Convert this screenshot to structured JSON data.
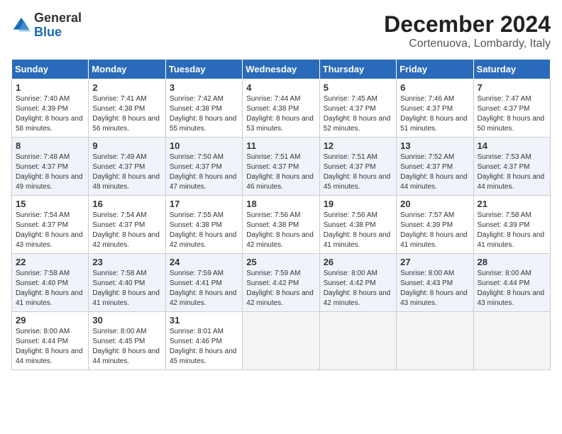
{
  "header": {
    "logo_general": "General",
    "logo_blue": "Blue",
    "title": "December 2024",
    "location": "Cortenuova, Lombardy, Italy"
  },
  "days_of_week": [
    "Sunday",
    "Monday",
    "Tuesday",
    "Wednesday",
    "Thursday",
    "Friday",
    "Saturday"
  ],
  "weeks": [
    [
      {
        "day": "1",
        "sunrise": "Sunrise: 7:40 AM",
        "sunset": "Sunset: 4:39 PM",
        "daylight": "Daylight: 8 hours and 58 minutes."
      },
      {
        "day": "2",
        "sunrise": "Sunrise: 7:41 AM",
        "sunset": "Sunset: 4:38 PM",
        "daylight": "Daylight: 8 hours and 56 minutes."
      },
      {
        "day": "3",
        "sunrise": "Sunrise: 7:42 AM",
        "sunset": "Sunset: 4:38 PM",
        "daylight": "Daylight: 8 hours and 55 minutes."
      },
      {
        "day": "4",
        "sunrise": "Sunrise: 7:44 AM",
        "sunset": "Sunset: 4:38 PM",
        "daylight": "Daylight: 8 hours and 53 minutes."
      },
      {
        "day": "5",
        "sunrise": "Sunrise: 7:45 AM",
        "sunset": "Sunset: 4:37 PM",
        "daylight": "Daylight: 8 hours and 52 minutes."
      },
      {
        "day": "6",
        "sunrise": "Sunrise: 7:46 AM",
        "sunset": "Sunset: 4:37 PM",
        "daylight": "Daylight: 8 hours and 51 minutes."
      },
      {
        "day": "7",
        "sunrise": "Sunrise: 7:47 AM",
        "sunset": "Sunset: 4:37 PM",
        "daylight": "Daylight: 8 hours and 50 minutes."
      }
    ],
    [
      {
        "day": "8",
        "sunrise": "Sunrise: 7:48 AM",
        "sunset": "Sunset: 4:37 PM",
        "daylight": "Daylight: 8 hours and 49 minutes."
      },
      {
        "day": "9",
        "sunrise": "Sunrise: 7:49 AM",
        "sunset": "Sunset: 4:37 PM",
        "daylight": "Daylight: 8 hours and 48 minutes."
      },
      {
        "day": "10",
        "sunrise": "Sunrise: 7:50 AM",
        "sunset": "Sunset: 4:37 PM",
        "daylight": "Daylight: 8 hours and 47 minutes."
      },
      {
        "day": "11",
        "sunrise": "Sunrise: 7:51 AM",
        "sunset": "Sunset: 4:37 PM",
        "daylight": "Daylight: 8 hours and 46 minutes."
      },
      {
        "day": "12",
        "sunrise": "Sunrise: 7:51 AM",
        "sunset": "Sunset: 4:37 PM",
        "daylight": "Daylight: 8 hours and 45 minutes."
      },
      {
        "day": "13",
        "sunrise": "Sunrise: 7:52 AM",
        "sunset": "Sunset: 4:37 PM",
        "daylight": "Daylight: 8 hours and 44 minutes."
      },
      {
        "day": "14",
        "sunrise": "Sunrise: 7:53 AM",
        "sunset": "Sunset: 4:37 PM",
        "daylight": "Daylight: 8 hours and 44 minutes."
      }
    ],
    [
      {
        "day": "15",
        "sunrise": "Sunrise: 7:54 AM",
        "sunset": "Sunset: 4:37 PM",
        "daylight": "Daylight: 8 hours and 43 minutes."
      },
      {
        "day": "16",
        "sunrise": "Sunrise: 7:54 AM",
        "sunset": "Sunset: 4:37 PM",
        "daylight": "Daylight: 8 hours and 42 minutes."
      },
      {
        "day": "17",
        "sunrise": "Sunrise: 7:55 AM",
        "sunset": "Sunset: 4:38 PM",
        "daylight": "Daylight: 8 hours and 42 minutes."
      },
      {
        "day": "18",
        "sunrise": "Sunrise: 7:56 AM",
        "sunset": "Sunset: 4:38 PM",
        "daylight": "Daylight: 8 hours and 42 minutes."
      },
      {
        "day": "19",
        "sunrise": "Sunrise: 7:56 AM",
        "sunset": "Sunset: 4:38 PM",
        "daylight": "Daylight: 8 hours and 41 minutes."
      },
      {
        "day": "20",
        "sunrise": "Sunrise: 7:57 AM",
        "sunset": "Sunset: 4:39 PM",
        "daylight": "Daylight: 8 hours and 41 minutes."
      },
      {
        "day": "21",
        "sunrise": "Sunrise: 7:58 AM",
        "sunset": "Sunset: 4:39 PM",
        "daylight": "Daylight: 8 hours and 41 minutes."
      }
    ],
    [
      {
        "day": "22",
        "sunrise": "Sunrise: 7:58 AM",
        "sunset": "Sunset: 4:40 PM",
        "daylight": "Daylight: 8 hours and 41 minutes."
      },
      {
        "day": "23",
        "sunrise": "Sunrise: 7:58 AM",
        "sunset": "Sunset: 4:40 PM",
        "daylight": "Daylight: 8 hours and 41 minutes."
      },
      {
        "day": "24",
        "sunrise": "Sunrise: 7:59 AM",
        "sunset": "Sunset: 4:41 PM",
        "daylight": "Daylight: 8 hours and 42 minutes."
      },
      {
        "day": "25",
        "sunrise": "Sunrise: 7:59 AM",
        "sunset": "Sunset: 4:42 PM",
        "daylight": "Daylight: 8 hours and 42 minutes."
      },
      {
        "day": "26",
        "sunrise": "Sunrise: 8:00 AM",
        "sunset": "Sunset: 4:42 PM",
        "daylight": "Daylight: 8 hours and 42 minutes."
      },
      {
        "day": "27",
        "sunrise": "Sunrise: 8:00 AM",
        "sunset": "Sunset: 4:43 PM",
        "daylight": "Daylight: 8 hours and 43 minutes."
      },
      {
        "day": "28",
        "sunrise": "Sunrise: 8:00 AM",
        "sunset": "Sunset: 4:44 PM",
        "daylight": "Daylight: 8 hours and 43 minutes."
      }
    ],
    [
      {
        "day": "29",
        "sunrise": "Sunrise: 8:00 AM",
        "sunset": "Sunset: 4:44 PM",
        "daylight": "Daylight: 8 hours and 44 minutes."
      },
      {
        "day": "30",
        "sunrise": "Sunrise: 8:00 AM",
        "sunset": "Sunset: 4:45 PM",
        "daylight": "Daylight: 8 hours and 44 minutes."
      },
      {
        "day": "31",
        "sunrise": "Sunrise: 8:01 AM",
        "sunset": "Sunset: 4:46 PM",
        "daylight": "Daylight: 8 hours and 45 minutes."
      },
      null,
      null,
      null,
      null
    ]
  ]
}
